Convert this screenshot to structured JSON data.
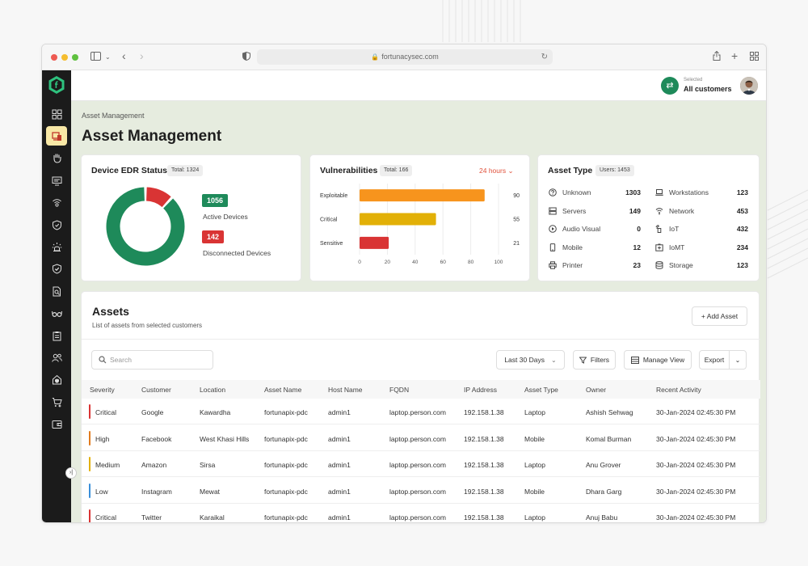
{
  "browser": {
    "url": "fortunacysec.com"
  },
  "topbar": {
    "selected_label": "Selected",
    "customer_label": "All customers"
  },
  "page": {
    "breadcrumb": "Asset Management",
    "title": "Asset Management"
  },
  "edr": {
    "title": "Device EDR Status",
    "total": "Total: 1324",
    "active_value": "1056",
    "active_label": "Active Devices",
    "disconnected_value": "142",
    "disconnected_label": "Disconnected Devices",
    "active_color": "#1e8a5a",
    "disconnected_color": "#d93434"
  },
  "vulnerabilities": {
    "title": "Vulnerabilities",
    "total": "Total: 166",
    "period": "24 hours",
    "chart_data": {
      "type": "bar",
      "orientation": "horizontal",
      "categories": [
        "Exploitable",
        "Critical",
        "Sensitive"
      ],
      "values": [
        90,
        55,
        21
      ],
      "colors": [
        "#f7941d",
        "#e2b007",
        "#d93434"
      ],
      "xlim": [
        0,
        100
      ],
      "xticks": [
        "0",
        "20",
        "40",
        "60",
        "80",
        "100"
      ],
      "grid": true
    }
  },
  "asset_type": {
    "title": "Asset Type",
    "users": "Users: 1453",
    "left": [
      {
        "icon": "question-icon",
        "name": "Unknown",
        "value": "1303"
      },
      {
        "icon": "server-icon",
        "name": "Servers",
        "value": "149"
      },
      {
        "icon": "play-icon",
        "name": "Audio Visual",
        "value": "0"
      },
      {
        "icon": "mobile-icon",
        "name": "Mobile",
        "value": "12"
      },
      {
        "icon": "printer-icon",
        "name": "Printer",
        "value": "23"
      }
    ],
    "right": [
      {
        "icon": "laptop-icon",
        "name": "Workstations",
        "value": "123"
      },
      {
        "icon": "network-icon",
        "name": "Network",
        "value": "453"
      },
      {
        "icon": "iot-icon",
        "name": "IoT",
        "value": "432"
      },
      {
        "icon": "iomt-icon",
        "name": "IoMT",
        "value": "234"
      },
      {
        "icon": "storage-icon",
        "name": "Storage",
        "value": "123"
      }
    ]
  },
  "assets": {
    "title": "Assets",
    "subtitle": "List of assets from selected customers",
    "add_button": "+ Add Asset",
    "search_placeholder": "Search",
    "date_filter": "Last 30 Days",
    "filters_button": "Filters",
    "manage_view_button": "Manage View",
    "export_button": "Export",
    "columns": [
      "Severity",
      "Customer",
      "Location",
      "Asset Name",
      "Host Name",
      "FQDN",
      "IP Address",
      "Asset Type",
      "Owner",
      "Recent Activity"
    ],
    "rows": [
      {
        "severity": "Critical",
        "sev_color": "#d93434",
        "customer": "Google",
        "location": "Kawardha",
        "asset": "fortunapix-pdc",
        "host": "admin1",
        "fqdn": "laptop.person.com",
        "ip": "192.158.1.38",
        "type": "Laptop",
        "owner": "Ashish Sehwag",
        "activity": "30-Jan-2024 02:45:30 PM"
      },
      {
        "severity": "High",
        "sev_color": "#e07b1e",
        "customer": "Facebook",
        "location": "West Khasi Hills",
        "asset": "fortunapix-pdc",
        "host": "admin1",
        "fqdn": "laptop.person.com",
        "ip": "192.158.1.38",
        "type": "Mobile",
        "owner": "Komal Burman",
        "activity": "30-Jan-2024 02:45:30 PM"
      },
      {
        "severity": "Medium",
        "sev_color": "#e2b007",
        "customer": "Amazon",
        "location": "Sirsa",
        "asset": "fortunapix-pdc",
        "host": "admin1",
        "fqdn": "laptop.person.com",
        "ip": "192.158.1.38",
        "type": "Laptop",
        "owner": "Anu Grover",
        "activity": "30-Jan-2024 02:45:30 PM"
      },
      {
        "severity": "Low",
        "sev_color": "#3a8fd9",
        "customer": "Instagram",
        "location": "Mewat",
        "asset": "fortunapix-pdc",
        "host": "admin1",
        "fqdn": "laptop.person.com",
        "ip": "192.158.1.38",
        "type": "Mobile",
        "owner": "Dhara Garg",
        "activity": "30-Jan-2024 02:45:30 PM"
      },
      {
        "severity": "Critical",
        "sev_color": "#d93434",
        "customer": "Twitter",
        "location": "Karaikal",
        "asset": "fortunapix-pdc",
        "host": "admin1",
        "fqdn": "laptop.person.com",
        "ip": "192.158.1.38",
        "type": "Laptop",
        "owner": "Anuj Babu",
        "activity": "30-Jan-2024 02:45:30 PM"
      }
    ]
  },
  "sidebar": {
    "items": [
      {
        "icon": "dashboard-icon",
        "active": false
      },
      {
        "icon": "asset-devices-icon",
        "active": true
      },
      {
        "icon": "hand-icon",
        "active": false
      },
      {
        "icon": "monitor-icon",
        "active": false
      },
      {
        "icon": "wireless-icon",
        "active": false
      },
      {
        "icon": "shield-icon",
        "active": false
      },
      {
        "icon": "alert-light-icon",
        "active": false
      },
      {
        "icon": "shield-check-icon",
        "active": false
      },
      {
        "icon": "file-search-icon",
        "active": false
      },
      {
        "icon": "glasses-icon",
        "active": false
      },
      {
        "icon": "clipboard-icon",
        "active": false
      },
      {
        "icon": "users-icon",
        "active": false
      },
      {
        "icon": "home-shield-icon",
        "active": false
      },
      {
        "icon": "cart-plus-icon",
        "active": false
      },
      {
        "icon": "wallet-icon",
        "active": false
      }
    ]
  }
}
